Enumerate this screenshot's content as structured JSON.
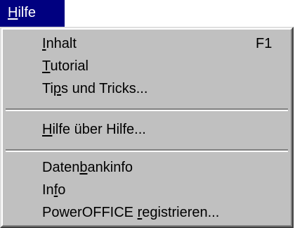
{
  "menubar": {
    "title_mnemonic": "H",
    "title_rest": "ilfe"
  },
  "menu": {
    "items": [
      {
        "pre": "",
        "mnemonic": "I",
        "post": "nhalt",
        "shortcut": "F1"
      },
      {
        "pre": "",
        "mnemonic": "T",
        "post": "utorial",
        "shortcut": ""
      },
      {
        "pre": "Ti",
        "mnemonic": "p",
        "post": "s und Tricks...",
        "shortcut": ""
      },
      {
        "pre": "",
        "mnemonic": "H",
        "post": "ilfe über Hilfe...",
        "shortcut": ""
      },
      {
        "pre": "Daten",
        "mnemonic": "b",
        "post": "ankinfo",
        "shortcut": ""
      },
      {
        "pre": "In",
        "mnemonic": "f",
        "post": "o",
        "shortcut": ""
      },
      {
        "pre": "PowerOFFICE ",
        "mnemonic": "r",
        "post": "egistrieren...",
        "shortcut": ""
      }
    ]
  },
  "colors": {
    "menu_bg": "#c0c0c0",
    "highlight_bg": "#000080",
    "highlight_text": "#ffffff"
  }
}
